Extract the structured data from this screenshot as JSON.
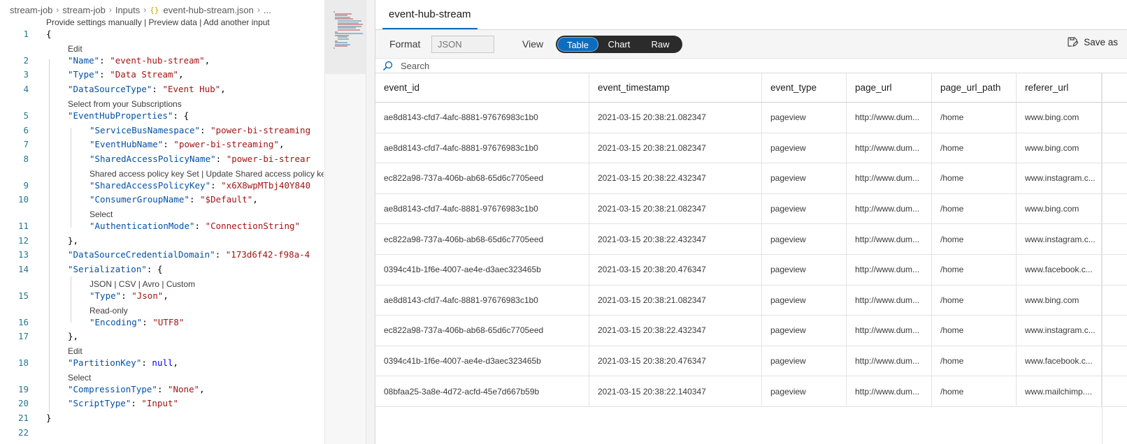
{
  "breadcrumb": [
    "stream-job",
    "stream-job",
    "Inputs",
    "event-hub-stream.json",
    "..."
  ],
  "breadcrumb_file_icon": "{}",
  "editor": {
    "lines": [
      {
        "n": "1",
        "lens": "Provide settings manually | Preview data | Add another input",
        "text": "{"
      },
      {
        "n": "2",
        "lens": "Edit",
        "key": "\"Name\"",
        "val": "\"event-hub-stream\"",
        "tail": ","
      },
      {
        "n": "3",
        "key": "\"Type\"",
        "val": "\"Data Stream\"",
        "tail": ","
      },
      {
        "n": "4",
        "key": "\"DataSourceType\"",
        "val": "\"Event Hub\"",
        "tail": ","
      },
      {
        "n": "5",
        "lens": "Select from your Subscriptions",
        "key": "\"EventHubProperties\"",
        "val": "",
        "tail": "{"
      },
      {
        "n": "6",
        "key": "\"ServiceBusNamespace\"",
        "val": "\"power-bi-streaming",
        "tail": ""
      },
      {
        "n": "7",
        "key": "\"EventHubName\"",
        "val": "\"power-bi-streaming\"",
        "tail": ","
      },
      {
        "n": "8",
        "key": "\"SharedAccessPolicyName\"",
        "val": "\"power-bi-strear",
        "tail": ""
      },
      {
        "n": "9",
        "lens": "Shared access policy key Set | Update Shared access policy ke",
        "key": "\"SharedAccessPolicyKey\"",
        "val": "\"x6X8wpMTbj40Y840",
        "tail": ""
      },
      {
        "n": "10",
        "key": "\"ConsumerGroupName\"",
        "val": "\"$Default\"",
        "tail": ","
      },
      {
        "n": "11",
        "lens": "Select",
        "key": "\"AuthenticationMode\"",
        "val": "\"ConnectionString\"",
        "tail": ""
      },
      {
        "n": "12",
        "text": "},"
      },
      {
        "n": "13",
        "key": "\"DataSourceCredentialDomain\"",
        "val": "\"173d6f42-f98a-4",
        "tail": ""
      },
      {
        "n": "14",
        "key": "\"Serialization\"",
        "val": "",
        "tail": "{"
      },
      {
        "n": "15",
        "lens": "JSON | CSV | Avro | Custom",
        "key": "\"Type\"",
        "val": "\"Json\"",
        "tail": ","
      },
      {
        "n": "16",
        "lens": "Read-only",
        "key": "\"Encoding\"",
        "val": "\"UTF8\"",
        "tail": ""
      },
      {
        "n": "17",
        "text": "},"
      },
      {
        "n": "18",
        "lens": "Edit",
        "key": "\"PartitionKey\"",
        "val": "null",
        "tail": ","
      },
      {
        "n": "19",
        "lens": "Select",
        "key": "\"CompressionType\"",
        "val": "\"None\"",
        "tail": ","
      },
      {
        "n": "20",
        "key": "\"ScriptType\"",
        "val": "\"Input\"",
        "tail": ""
      },
      {
        "n": "21",
        "text": "}"
      },
      {
        "n": "22",
        "text": ""
      }
    ]
  },
  "preview": {
    "tab": "event-hub-stream",
    "format_label": "Format",
    "format_placeholder": "JSON",
    "view_label": "View",
    "view_options": [
      "Table",
      "Chart",
      "Raw"
    ],
    "view_selected": "Table",
    "save_as": "Save as",
    "search_placeholder": "Search",
    "columns": [
      "event_id",
      "event_timestamp",
      "event_type",
      "page_url",
      "page_url_path",
      "referer_url",
      ""
    ],
    "rows": [
      [
        "ae8d8143-cfd7-4afc-8881-97676983c1b0",
        "2021-03-15 20:38:21.082347",
        "pageview",
        "http://www.dum...",
        "/home",
        "www.bing.com"
      ],
      [
        "ae8d8143-cfd7-4afc-8881-97676983c1b0",
        "2021-03-15 20:38:21.082347",
        "pageview",
        "http://www.dum...",
        "/home",
        "www.bing.com"
      ],
      [
        "ec822a98-737a-406b-ab68-65d6c7705eed",
        "2021-03-15 20:38:22.432347",
        "pageview",
        "http://www.dum...",
        "/home",
        "www.instagram.c..."
      ],
      [
        "ae8d8143-cfd7-4afc-8881-97676983c1b0",
        "2021-03-15 20:38:21.082347",
        "pageview",
        "http://www.dum...",
        "/home",
        "www.bing.com"
      ],
      [
        "ec822a98-737a-406b-ab68-65d6c7705eed",
        "2021-03-15 20:38:22.432347",
        "pageview",
        "http://www.dum...",
        "/home",
        "www.instagram.c..."
      ],
      [
        "0394c41b-1f6e-4007-ae4e-d3aec323465b",
        "2021-03-15 20:38:20.476347",
        "pageview",
        "http://www.dum...",
        "/home",
        "www.facebook.c..."
      ],
      [
        "ae8d8143-cfd7-4afc-8881-97676983c1b0",
        "2021-03-15 20:38:21.082347",
        "pageview",
        "http://www.dum...",
        "/home",
        "www.bing.com"
      ],
      [
        "ec822a98-737a-406b-ab68-65d6c7705eed",
        "2021-03-15 20:38:22.432347",
        "pageview",
        "http://www.dum...",
        "/home",
        "www.instagram.c..."
      ],
      [
        "0394c41b-1f6e-4007-ae4e-d3aec323465b",
        "2021-03-15 20:38:20.476347",
        "pageview",
        "http://www.dum...",
        "/home",
        "www.facebook.c..."
      ],
      [
        "08bfaa25-3a8e-4d72-acfd-45e7d667b59b",
        "2021-03-15 20:38:22.140347",
        "pageview",
        "http://www.dum...",
        "/home",
        "www.mailchimp...."
      ]
    ]
  },
  "colors": {
    "accent": "#0f6cbd",
    "toggle_bg": "#2b2b2b",
    "json_key": "#0451a5",
    "json_string": "#a31515",
    "line_number": "#237893"
  },
  "icons": [
    "file-braces-icon",
    "chevron-right-icon",
    "search-icon",
    "save-as-icon"
  ]
}
